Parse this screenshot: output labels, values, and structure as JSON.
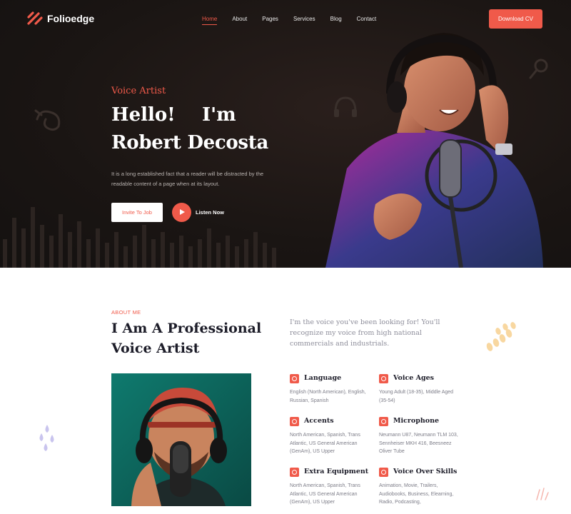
{
  "brand": {
    "name": "Folioedge",
    "accent": "#f05a4a"
  },
  "nav": {
    "items": [
      {
        "label": "Home",
        "active": true
      },
      {
        "label": "About",
        "active": false
      },
      {
        "label": "Pages",
        "active": false
      },
      {
        "label": "Services",
        "active": false
      },
      {
        "label": "Blog",
        "active": false
      },
      {
        "label": "Contact",
        "active": false
      }
    ],
    "cta": "Download CV"
  },
  "hero": {
    "role": "Voice Artist",
    "hello": "Hello!",
    "im": "I'm",
    "name": "Robert Decosta",
    "intro": "It is a long established fact that a reader will be distracted by the readable content of a page when at its layout.",
    "invite_button": "Invite To Job",
    "listen_label": "Listen Now"
  },
  "about": {
    "label": "ABOUT ME",
    "title": "I Am A Professional Voice Artist",
    "lead": "I'm the voice you've been looking for! You'll recognize my voice from high national commercials and industrials.",
    "specs": [
      {
        "title": "Language",
        "text": "English (North American), English, Russian, Spanish",
        "icon": "language-icon"
      },
      {
        "title": "Voice Ages",
        "text": "Young Adult (18-35), Middle Aged (35-54)",
        "icon": "voice-ages-icon"
      },
      {
        "title": "Accents",
        "text": "North American, Spanish, Trans Atlantic, US General American (GenAm), US Upper",
        "icon": "accents-icon"
      },
      {
        "title": "Microphone",
        "text": "Neumann U87, Neumann TLM 103, Sennheiser MKH 416, Beesneez Oliver Tube",
        "icon": "microphone-icon"
      },
      {
        "title": "Extra Equipment",
        "text": "North American, Spanish, Trans Atlantic, US General American (GenAm), US Upper",
        "icon": "equipment-icon"
      },
      {
        "title": "Voice Over Skills",
        "text": "Animation, Movie, Trailers, Audiobooks, Business, Elearning, Radio, Podcasting,",
        "icon": "skills-icon"
      }
    ]
  }
}
